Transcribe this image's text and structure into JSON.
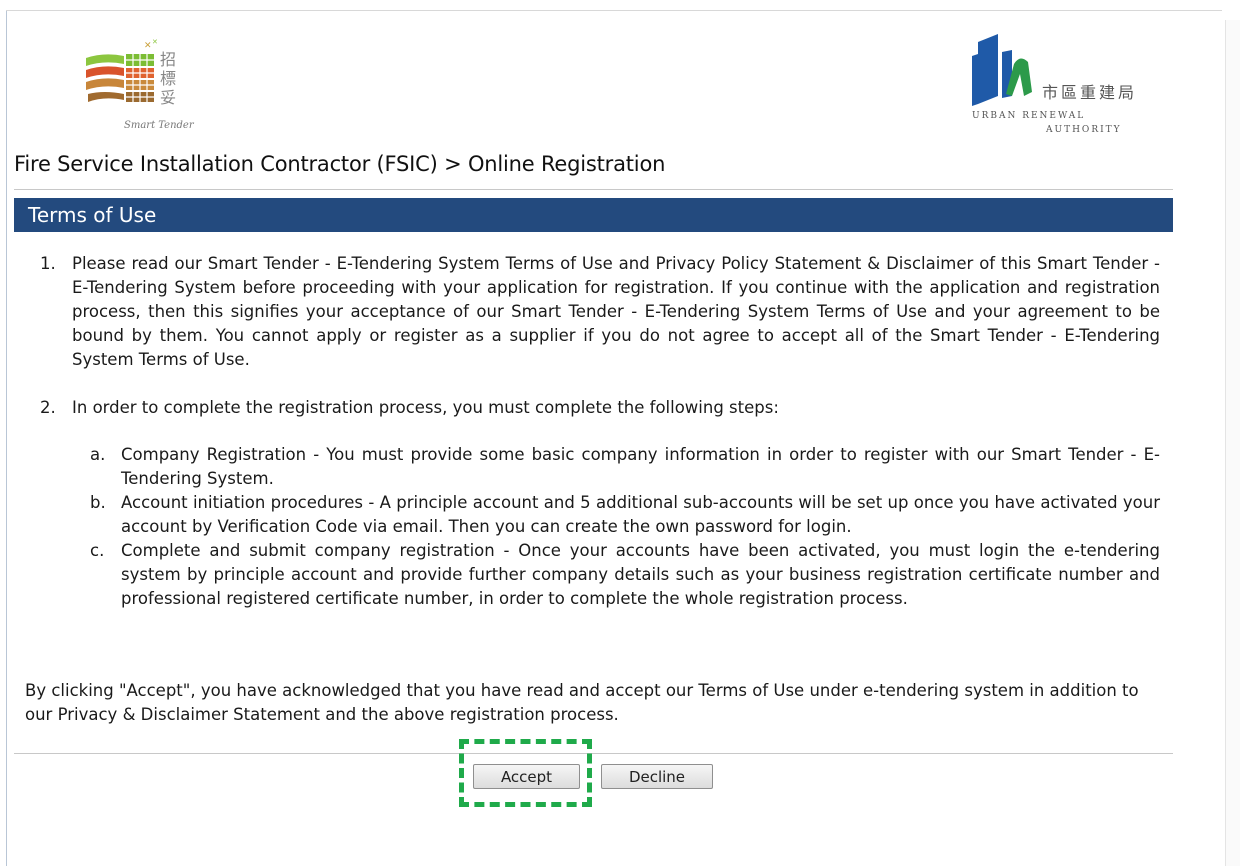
{
  "logos": {
    "smart_tender": {
      "chinese": "招標妥",
      "english": "Smart Tender"
    },
    "ura": {
      "chinese": "市區重建局",
      "english_line1": "URBAN RENEWAL",
      "english_line2": "AUTHORITY"
    }
  },
  "page_title": "Fire Service Installation Contractor (FSIC) > Online Registration",
  "section": {
    "title": "Terms of Use"
  },
  "terms": [
    {
      "num": "1.",
      "text": "Please read our Smart Tender - E-Tendering System Terms of Use and Privacy Policy Statement & Disclaimer of this Smart Tender - E-Tendering System before proceeding with your application for registration. If you continue with the application and registration process, then this signifies your acceptance of our Smart Tender - E-Tendering System Terms of Use and your agreement to be bound by them. You cannot apply or register as a supplier if you do not agree to accept all of the Smart Tender - E-Tendering System Terms of Use."
    },
    {
      "num": "2.",
      "text": "In order to complete the registration process, you must complete the following steps:"
    }
  ],
  "steps": [
    {
      "letter": "a.",
      "text": "Company Registration - You must provide some basic company information in order to register with our Smart Tender - E-Tendering System."
    },
    {
      "letter": "b.",
      "text": "Account initiation procedures - A principle account and 5 additional sub-accounts will be set up once you have activated your account by Verification Code via email. Then you can create the own password for login."
    },
    {
      "letter": "c.",
      "text": "Complete and submit company registration - Once your accounts have been activated, you must login the e-tendering system by principle account and provide further company details such as your business registration certificate number and professional registered certificate number, in order to complete the whole registration process."
    }
  ],
  "acknowledgement": "By clicking \"Accept\", you have acknowledged that you have read and accept our Terms of Use under e-tendering system in addition to our Privacy & Disclaimer Statement and the above registration process.",
  "buttons": {
    "accept": "Accept",
    "decline": "Decline"
  },
  "colors": {
    "header_bg": "#234a7e",
    "highlight": "#1faa4a",
    "ura_blue": "#1f5aa8",
    "ura_green": "#2c9a4a"
  }
}
